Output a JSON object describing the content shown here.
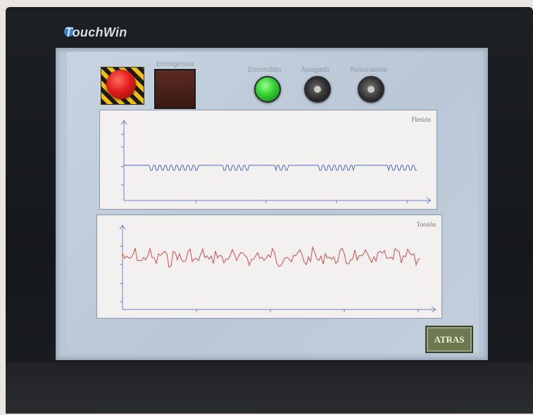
{
  "brand": {
    "name": "TouchWin"
  },
  "labels": {
    "emergencia": "Emergencia",
    "encendido": "Encendido",
    "apagado": "Apagado",
    "resonancia": "Resonancia"
  },
  "charts": {
    "flexion_title": "Flexión",
    "torsion_title": "Torsión"
  },
  "buttons": {
    "atras": "ATRAS"
  },
  "colors": {
    "flexion_line": "#4d68c8",
    "torsion_line": "#d94a4a",
    "axis": "#6d7fd1"
  }
}
